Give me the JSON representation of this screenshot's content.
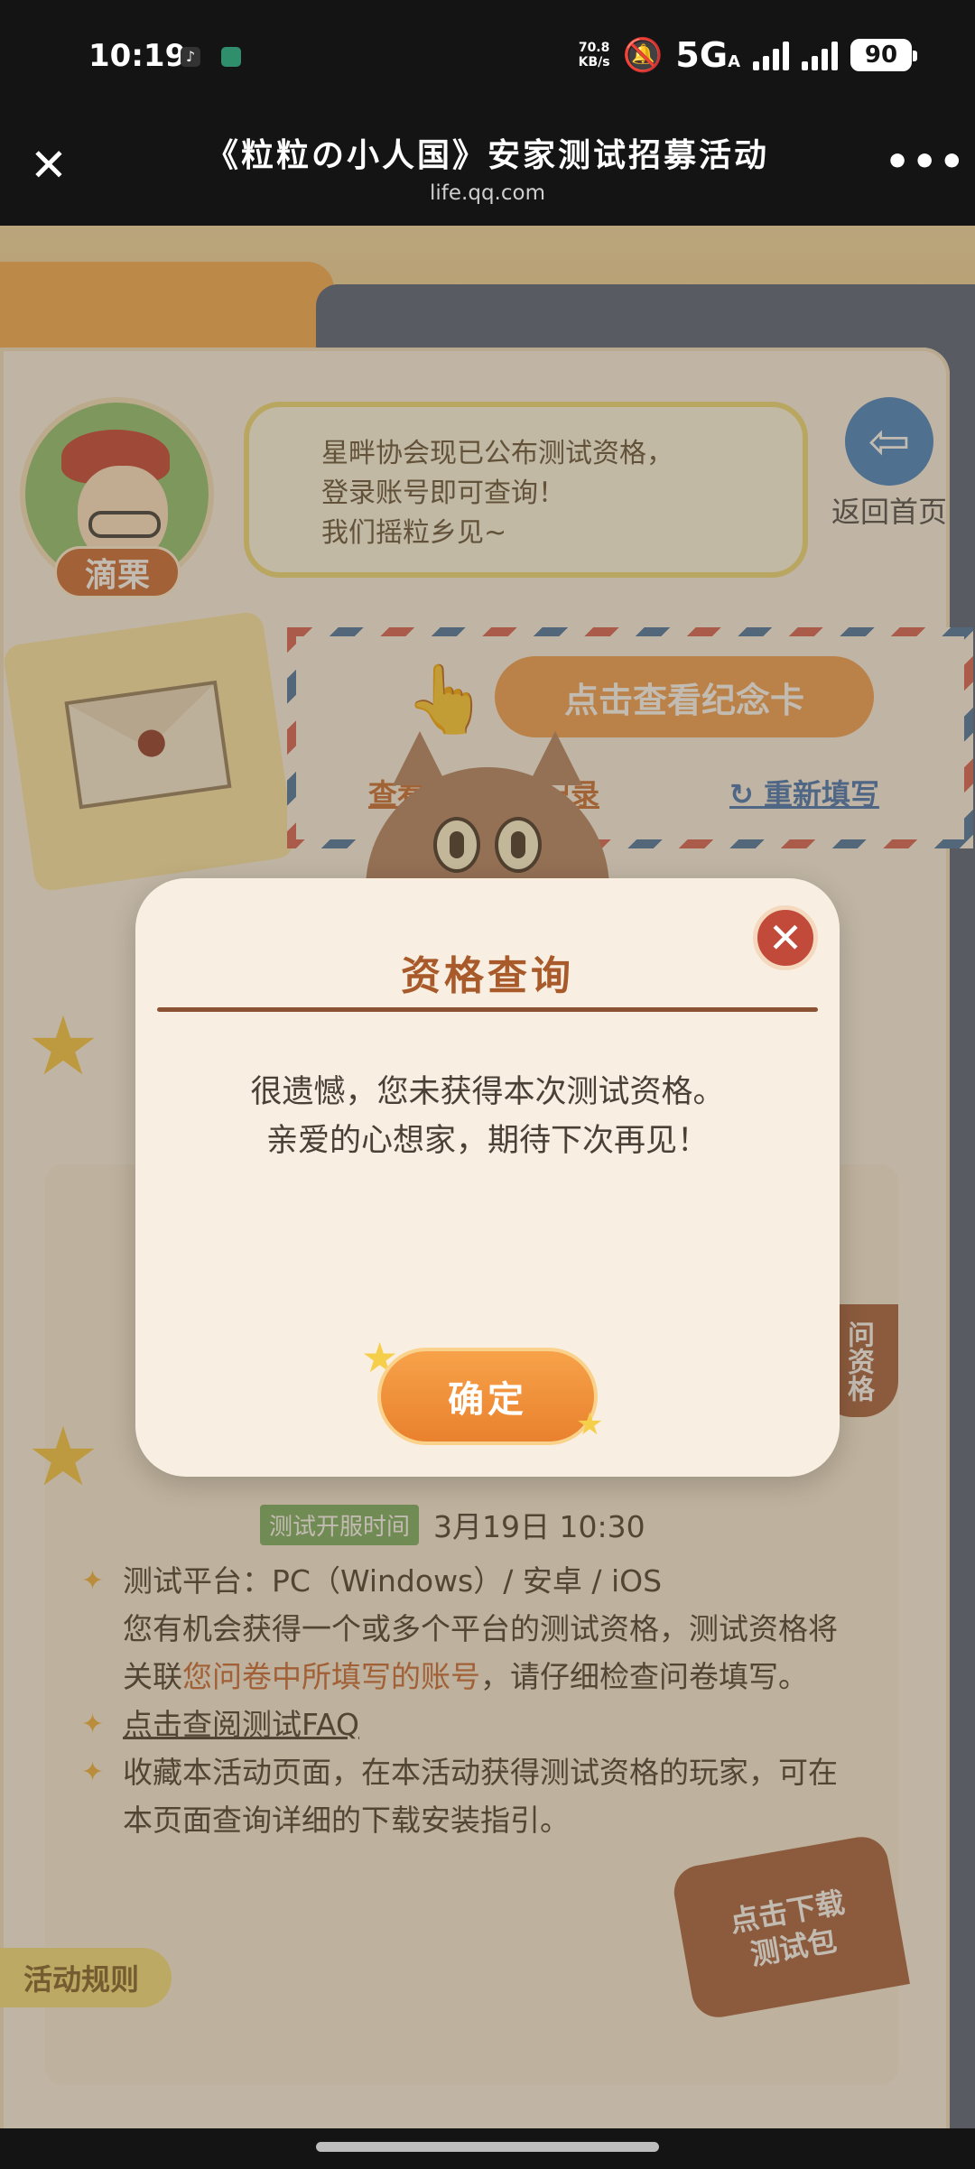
{
  "status_bar": {
    "time": "10:19",
    "net_speed_value": "70.8",
    "net_speed_unit": "KB/s",
    "network": "5G",
    "network_suffix": "A",
    "battery": "90"
  },
  "nav": {
    "title": "《粒粒の小人国》安家测试招募活动",
    "url": "life.qq.com",
    "close_icon": "close-icon",
    "more_icon": "more-icon"
  },
  "page": {
    "npc_name": "滴栗",
    "bubble_lines": [
      "星畔协会现已公布测试资格，",
      "登录账号即可查询！",
      "我们摇粒乡见~"
    ],
    "back_home_label": "返回首页",
    "memorial_button": "点击查看纪念卡",
    "view_link": "查看问卷填写记录",
    "refill_link": "重新填写",
    "test_time_tag": "测试开服时间",
    "test_time_value": "3月19日  10:30",
    "info": {
      "platform": "测试平台：PC（Windows）/ 安卓 / iOS",
      "chance_prefix": "您有机会获得一个或多个平台的测试资格，测试资格将关联",
      "chance_highlight": "您问卷中所填写的账号",
      "chance_suffix": "，请仔细检查问卷填写。",
      "faq_link": "点击查阅测试FAQ",
      "bookmark": "收藏本活动页面，在本活动获得测试资格的玩家，可在本页面查询详细的下载安装指引。"
    },
    "side_badge": "问资格",
    "download_badge_line1": "点击下载",
    "download_badge_line2": "测试包",
    "rules_tab": "活动规则"
  },
  "modal": {
    "title": "资格查询",
    "message_line1": "很遗憾，您未获得本次测试资格。",
    "message_line2": "亲爱的心想家，期待下次再见！",
    "confirm_button": "确定",
    "close_icon": "close-icon"
  },
  "colors": {
    "accent_orange": "#e9812e",
    "title_brown": "#a85a2a",
    "close_red": "#c24a3a",
    "link_blue": "#3a6fb4"
  }
}
